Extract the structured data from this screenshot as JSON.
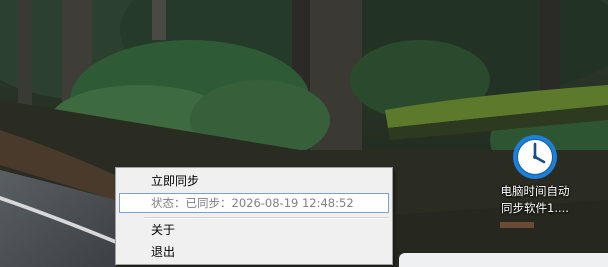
{
  "context_menu": {
    "sync_now_label": "立即同步",
    "status_label": "状态：已同步：2026-08-19 12:48:52",
    "about_label": "关于",
    "exit_label": "退出"
  },
  "desktop_icon": {
    "icon_name": "clock-icon",
    "label_line1": "电脑时间自动",
    "label_line2": "同步软件1....",
    "accent_color": "#1e7fd8"
  }
}
